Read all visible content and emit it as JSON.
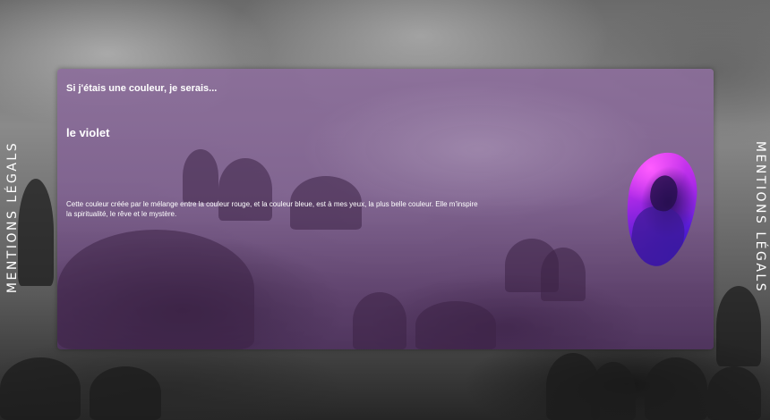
{
  "side_links": {
    "left_label": "MENTIONS LÉGALS",
    "right_label": "MENTIONS LÉGALS"
  },
  "card": {
    "intro": "Si j'étais une couleur, je serais...",
    "color_name": "le violet",
    "description_line1": "Cette couleur créée par le mélange entre la couleur rouge, et la couleur bleue, est à mes yeux, la plus belle couleur. Elle m'inspire",
    "description_line2": "la spiritualité, le rêve et le mystère.",
    "accent_color": "#8a6a9a"
  },
  "icons": {
    "portrait": "portrait-image"
  }
}
